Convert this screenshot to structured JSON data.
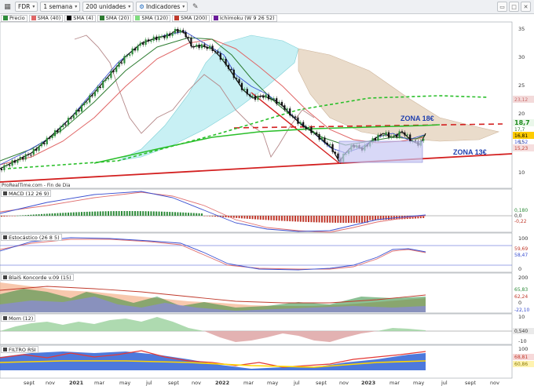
{
  "toolbar": {
    "symbol": "FDR",
    "period": "1 semana",
    "units": "200 unidades",
    "indicators": "Indicadores"
  },
  "legend": {
    "price": "Precio",
    "sma40": "SMA (40)",
    "sma4": "SMA (4)",
    "sma20": "SMA (20)",
    "sma120": "SMA (120)",
    "sma200": "SMA (200)",
    "ichimoku": "Ichimoku (W 9 26 52)"
  },
  "colors": {
    "sma40": "#e06666",
    "sma4": "#000000",
    "sma20": "#2e7d32",
    "sma120": "#7fdc7f",
    "sma200": "#c0392b",
    "ichimoku": "#6a1b9a",
    "candle_up": "#2e8b3a",
    "candle_down": "#111111"
  },
  "source": "ProRealTime.com - Fin de Dia",
  "annotations": {
    "zona18": "ZONA 18€",
    "zona13": "ZONA 13€"
  },
  "price_axis": [
    "35",
    "30",
    "25",
    "20",
    "15",
    "10"
  ],
  "price_tags": [
    "23,12",
    "18,7",
    "17,7",
    "16,81",
    "16,52",
    "15,23"
  ],
  "panes": {
    "macd": {
      "label": "MACD (12 26 9)",
      "ticks": [
        "0,180",
        "0,0",
        "-0,22"
      ]
    },
    "stoch": {
      "label": "Estocástico (26 8 5)",
      "ticks": [
        "100",
        "59,69",
        "58,47",
        "0"
      ]
    },
    "koncorde": {
      "label": "BlaiS Koncorde v.09 (15)",
      "ticks": [
        "200",
        "65,83",
        "62,24",
        "0",
        "-22,10"
      ]
    },
    "mom": {
      "label": "Mom (12)",
      "ticks": [
        "10",
        "0,540",
        "-10"
      ]
    },
    "rsi": {
      "label": "FILTRO RSI",
      "ticks": [
        "100",
        "68,81",
        "60,86"
      ]
    }
  },
  "x_axis": [
    "sept",
    "nov",
    "2021",
    "mar",
    "may",
    "jul",
    "sept",
    "nov",
    "2022",
    "mar",
    "may",
    "jul",
    "sept",
    "nov",
    "2023",
    "mar",
    "may",
    "jul",
    "sept",
    "nov"
  ]
}
